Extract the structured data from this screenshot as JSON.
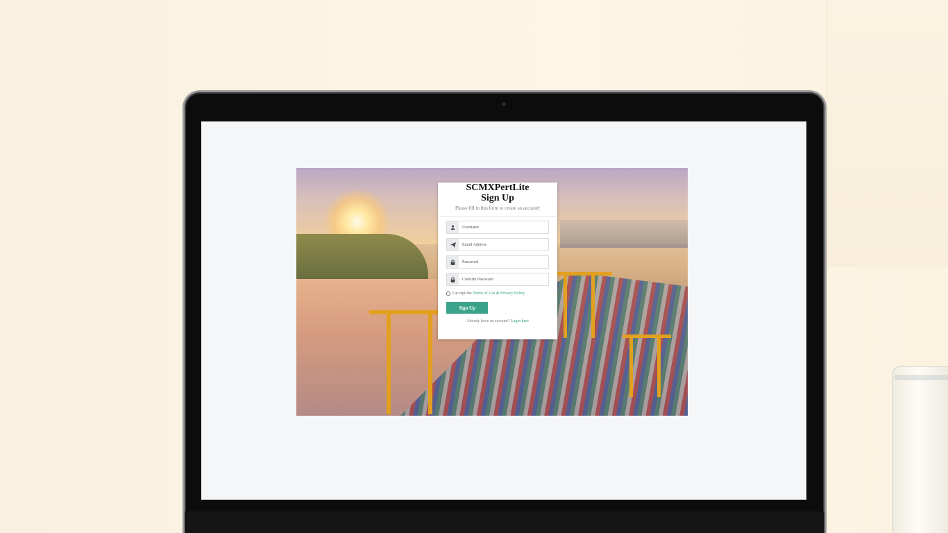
{
  "form": {
    "brand": "SCMXPertLite",
    "title": "Sign Up",
    "subtitle": "Please fill in this form to create an account!",
    "fields": [
      {
        "icon": "user-icon",
        "placeholder": "Username"
      },
      {
        "icon": "paper-plane-icon",
        "placeholder": "Email Address"
      },
      {
        "icon": "lock-icon",
        "placeholder": "Password"
      },
      {
        "icon": "lock-icon",
        "placeholder": "Confirm Password"
      }
    ],
    "terms_prefix": "I accept the ",
    "terms_link": "Terms of Use & Privacy Policy",
    "submit_label": "Sign Up",
    "login_prefix": "Already have an account? ",
    "login_link": "Login here"
  },
  "colors": {
    "accent": "#3aa389",
    "link": "#2f9a84"
  }
}
